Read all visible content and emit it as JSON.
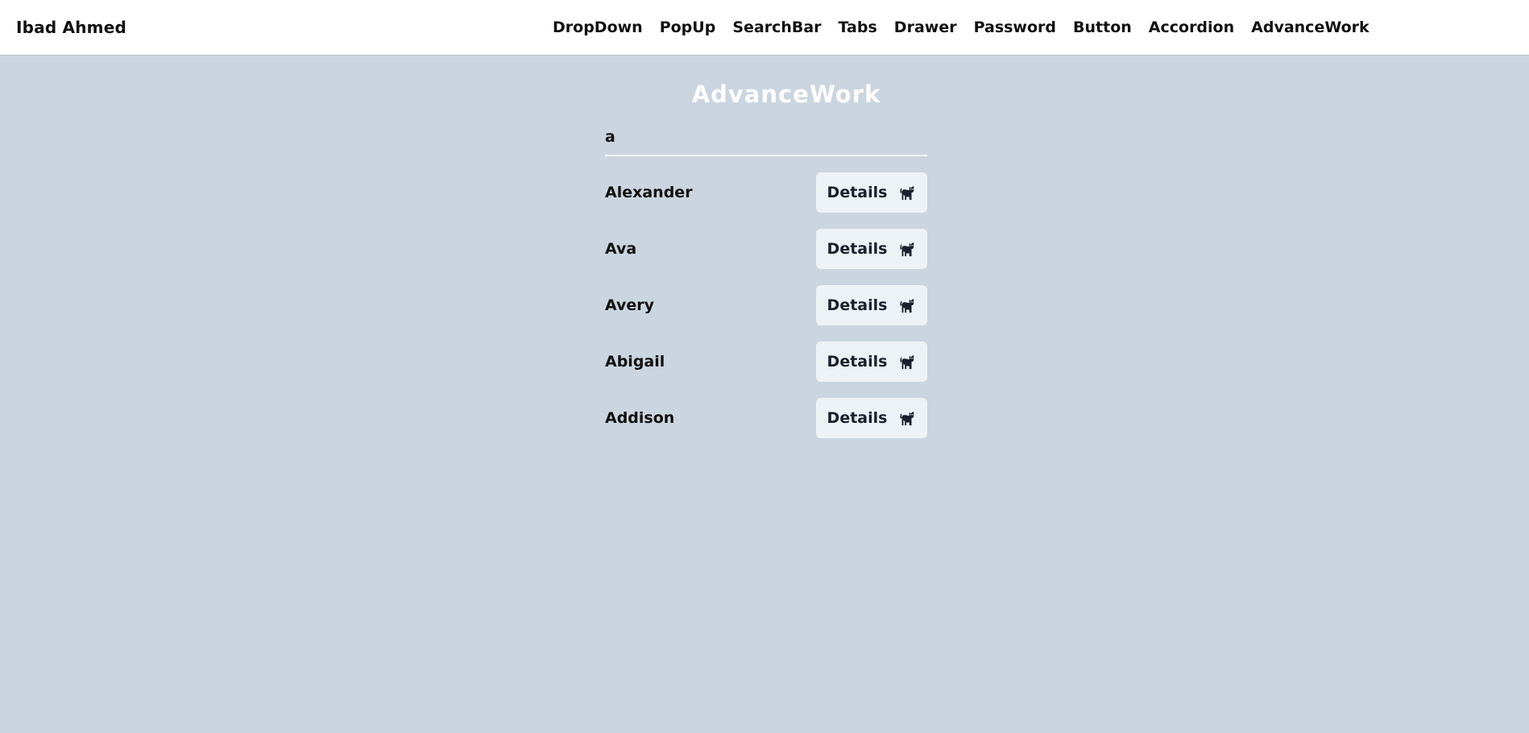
{
  "header": {
    "brand": "Ibad Ahmed",
    "nav": [
      {
        "label": "DropDown"
      },
      {
        "label": "PopUp"
      },
      {
        "label": "SearchBar"
      },
      {
        "label": "Tabs"
      },
      {
        "label": "Drawer"
      },
      {
        "label": "Password"
      },
      {
        "label": "Button"
      },
      {
        "label": "Accordion"
      },
      {
        "label": "AdvanceWork"
      }
    ]
  },
  "main": {
    "title": "AdvanceWork",
    "search": {
      "value": "a"
    },
    "results": [
      {
        "name": "Alexander",
        "button_label": "Details",
        "icon": "cat-icon"
      },
      {
        "name": "Ava",
        "button_label": "Details",
        "icon": "cat-icon"
      },
      {
        "name": "Avery",
        "button_label": "Details",
        "icon": "cat-icon"
      },
      {
        "name": "Abigail",
        "button_label": "Details",
        "icon": "cat-icon"
      },
      {
        "name": "Addison",
        "button_label": "Details",
        "icon": "cat-icon"
      }
    ]
  },
  "colors": {
    "background": "#cbd5e0",
    "navbar": "#ffffff",
    "button_bg": "#edf2f7",
    "button_text": "#1a202c"
  }
}
